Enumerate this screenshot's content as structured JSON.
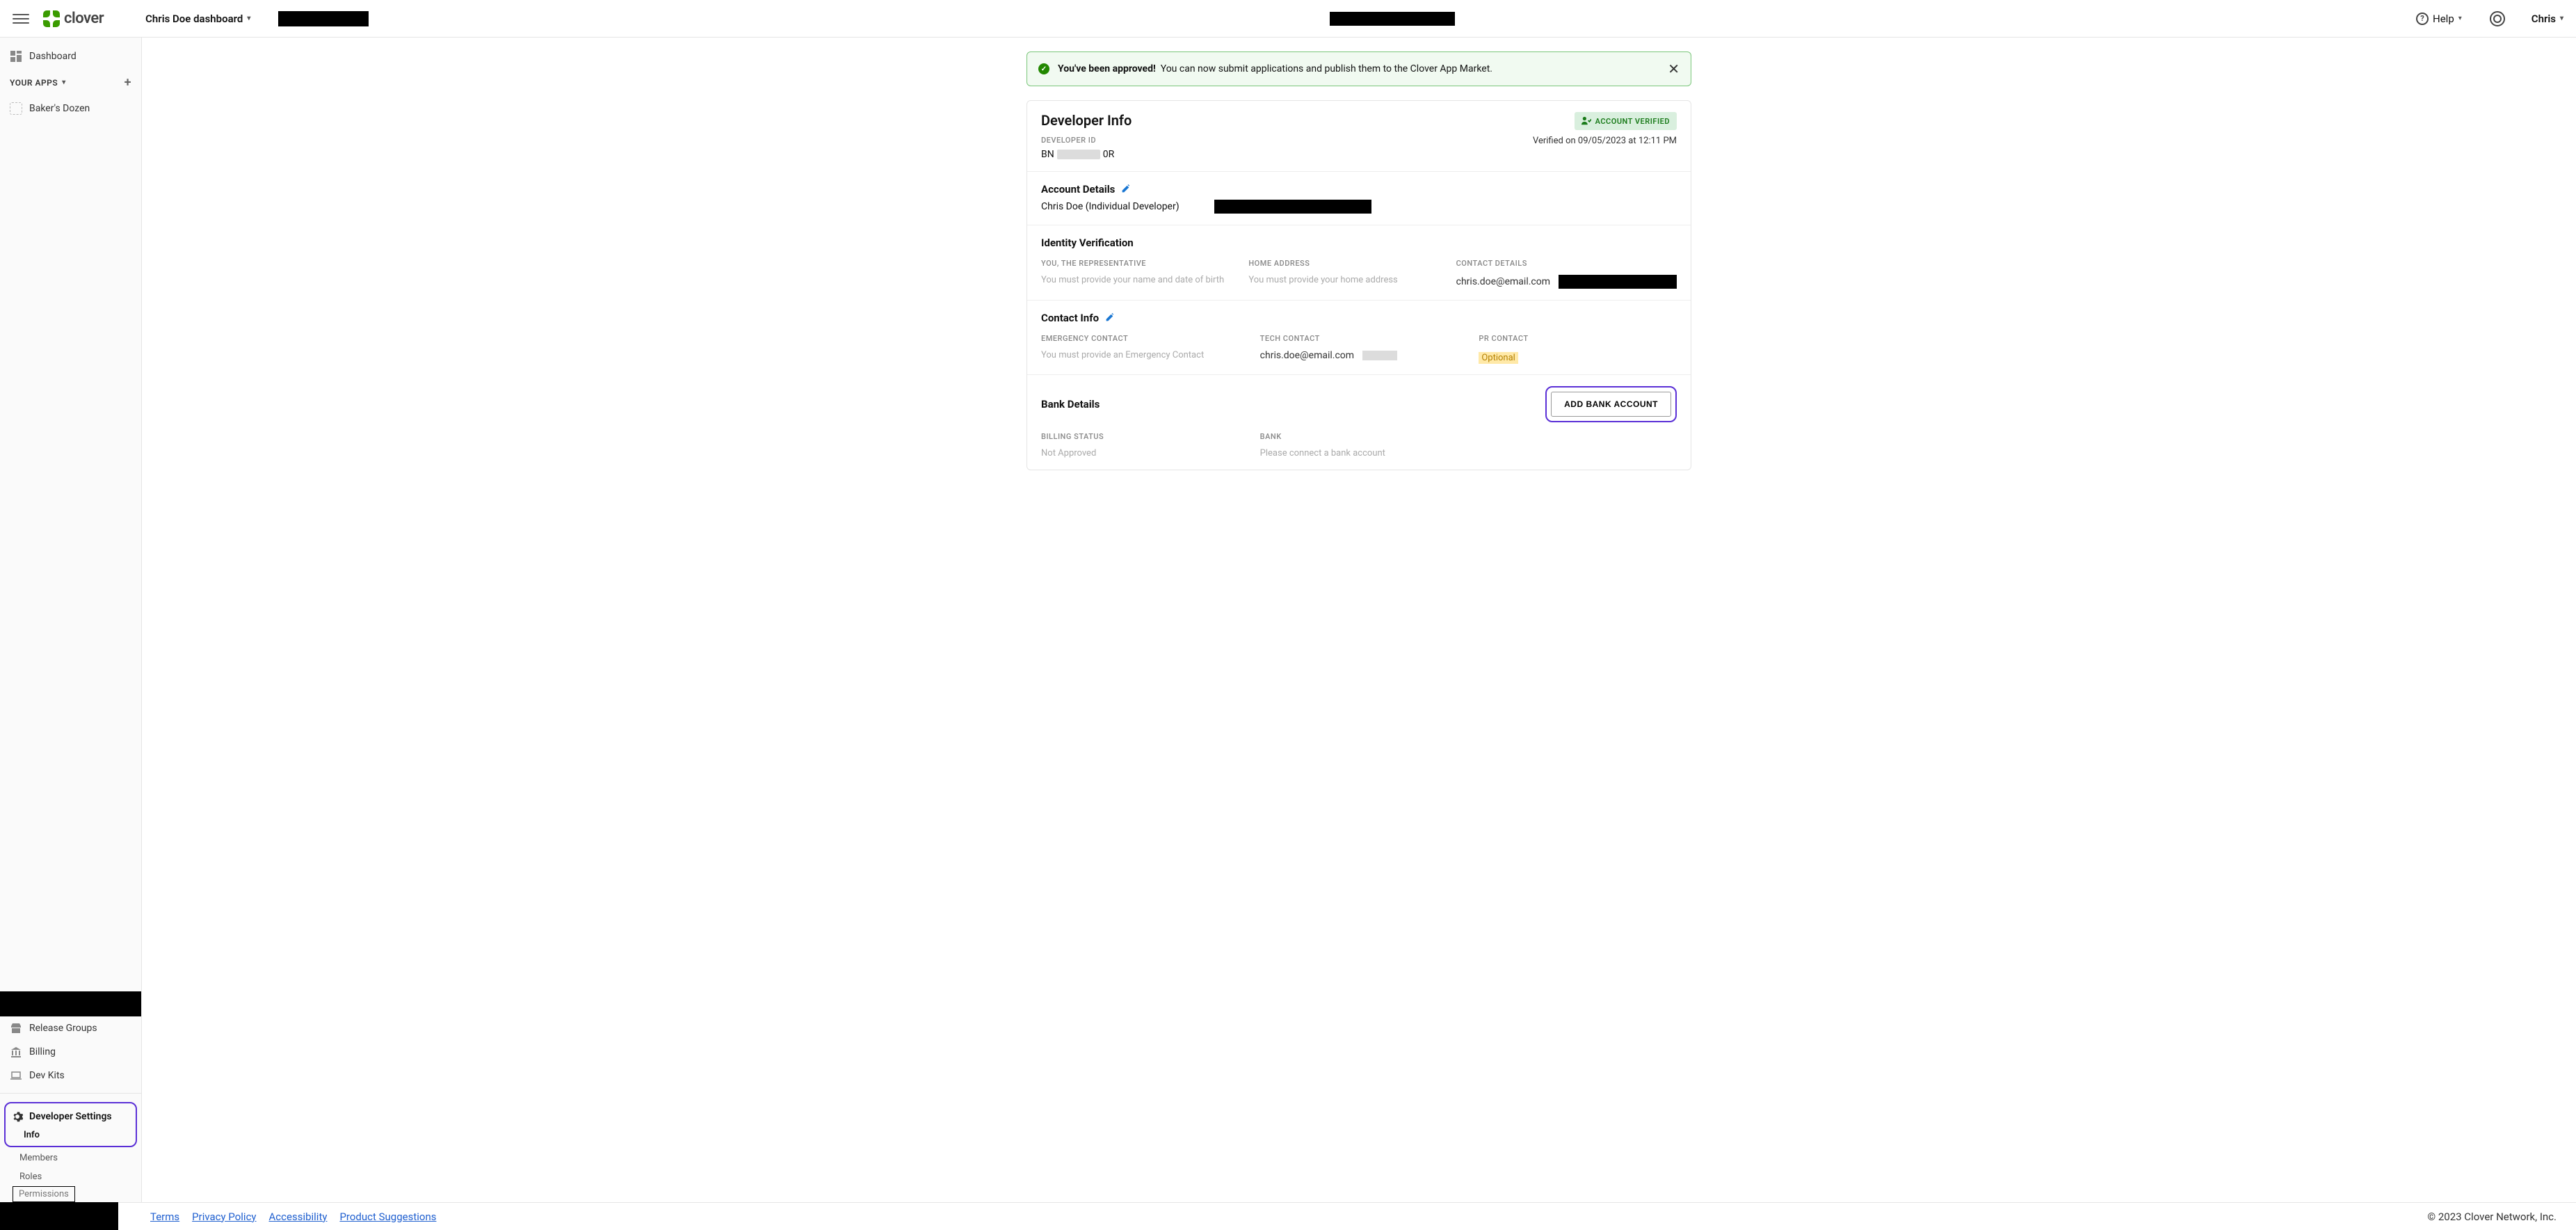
{
  "header": {
    "logo_text": "clover",
    "dashboard_selector": "Chris Doe dashboard",
    "help_label": "Help",
    "user_name": "Chris"
  },
  "sidebar": {
    "dashboard": "Dashboard",
    "your_apps_label": "YOUR APPS",
    "apps": [
      {
        "name": "Baker's Dozen"
      }
    ],
    "release_groups": "Release Groups",
    "billing": "Billing",
    "dev_kits": "Dev Kits",
    "developer_settings": "Developer Settings",
    "dev_info": "Info",
    "dev_members": "Members",
    "dev_roles": "Roles",
    "dev_permissions": "Permissions"
  },
  "alert": {
    "strong": "You've been approved!",
    "text": "You can now submit applications and publish them to the Clover App Market."
  },
  "dev_info": {
    "title": "Developer Info",
    "id_label": "DEVELOPER ID",
    "id_prefix": "BN",
    "id_suffix": "0R",
    "badge": "ACCOUNT VERIFIED",
    "verified_text": "Verified on 09/05/2023 at 12:11 PM"
  },
  "account_details": {
    "title": "Account Details",
    "name": "Chris Doe (Individual Developer)"
  },
  "identity": {
    "title": "Identity Verification",
    "rep_label": "YOU, THE REPRESENTATIVE",
    "rep_text": "You must provide your name and date of birth",
    "home_label": "HOME ADDRESS",
    "home_text": "You must provide your home address",
    "contact_label": "CONTACT DETAILS",
    "contact_email": "chris.doe@email.com"
  },
  "contact_info": {
    "title": "Contact Info",
    "emerg_label": "EMERGENCY CONTACT",
    "emerg_text": "You must provide an Emergency Contact",
    "tech_label": "TECH CONTACT",
    "tech_email": "chris.doe@email.com",
    "pr_label": "PR CONTACT",
    "pr_text": "Optional"
  },
  "bank": {
    "title": "Bank Details",
    "add_btn": "ADD BANK ACCOUNT",
    "billing_label": "BILLING STATUS",
    "billing_text": "Not Approved",
    "bank_label": "BANK",
    "bank_text": "Please connect a bank account"
  },
  "footer": {
    "terms": "Terms",
    "privacy": "Privacy Policy",
    "accessibility": "Accessibility",
    "suggestions": "Product Suggestions",
    "copyright": "© 2023 Clover Network, Inc."
  }
}
